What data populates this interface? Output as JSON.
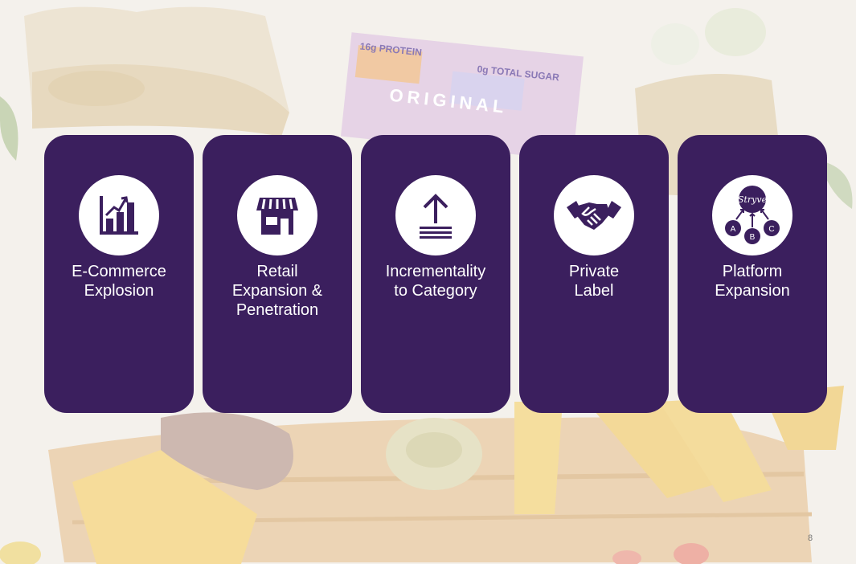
{
  "cards": [
    {
      "icon": "growth-chart-icon",
      "label": "E-Commerce\nExplosion"
    },
    {
      "icon": "storefront-icon",
      "label": "Retail\nExpansion &\nPenetration"
    },
    {
      "icon": "upload-arrow-icon",
      "label": "Incrementality\nto Category"
    },
    {
      "icon": "handshake-icon",
      "label": "Private\nLabel"
    },
    {
      "icon": "platform-network-icon",
      "label": "Platform\nExpansion"
    }
  ],
  "platform_icon": {
    "center_text": "Stryve",
    "nodes": [
      "A",
      "B",
      "C"
    ]
  },
  "background_packaging": {
    "protein": "16g PROTEIN",
    "sugar": "0g TOTAL SUGAR",
    "flavor": "ORIGINAL"
  },
  "page_number": "8",
  "colors": {
    "card": "#3b1f5e",
    "icon_circle": "#ffffff",
    "text": "#ffffff"
  }
}
